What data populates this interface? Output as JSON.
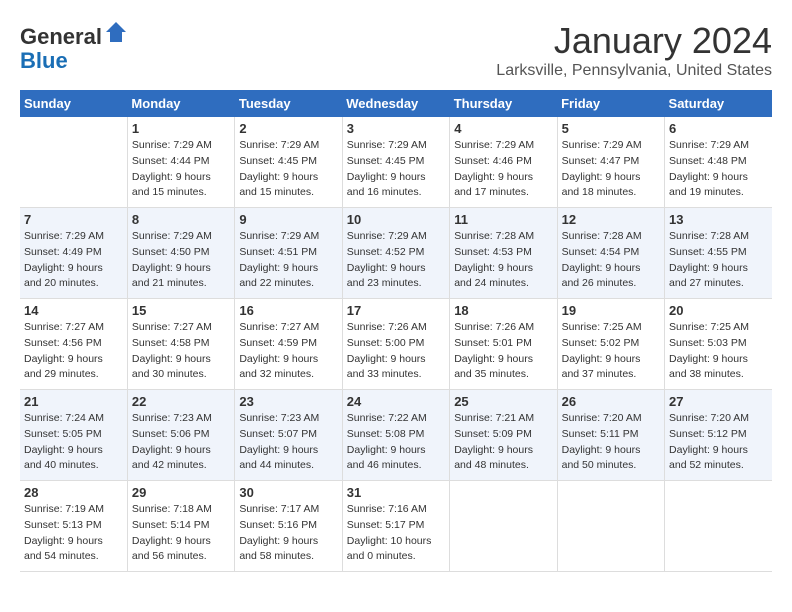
{
  "header": {
    "logo_general": "General",
    "logo_blue": "Blue",
    "month_title": "January 2024",
    "location": "Larksville, Pennsylvania, United States"
  },
  "days_of_week": [
    "Sunday",
    "Monday",
    "Tuesday",
    "Wednesday",
    "Thursday",
    "Friday",
    "Saturday"
  ],
  "weeks": [
    [
      {
        "day": "",
        "info": ""
      },
      {
        "day": "1",
        "info": "Sunrise: 7:29 AM\nSunset: 4:44 PM\nDaylight: 9 hours\nand 15 minutes."
      },
      {
        "day": "2",
        "info": "Sunrise: 7:29 AM\nSunset: 4:45 PM\nDaylight: 9 hours\nand 15 minutes."
      },
      {
        "day": "3",
        "info": "Sunrise: 7:29 AM\nSunset: 4:45 PM\nDaylight: 9 hours\nand 16 minutes."
      },
      {
        "day": "4",
        "info": "Sunrise: 7:29 AM\nSunset: 4:46 PM\nDaylight: 9 hours\nand 17 minutes."
      },
      {
        "day": "5",
        "info": "Sunrise: 7:29 AM\nSunset: 4:47 PM\nDaylight: 9 hours\nand 18 minutes."
      },
      {
        "day": "6",
        "info": "Sunrise: 7:29 AM\nSunset: 4:48 PM\nDaylight: 9 hours\nand 19 minutes."
      }
    ],
    [
      {
        "day": "7",
        "info": "Sunrise: 7:29 AM\nSunset: 4:49 PM\nDaylight: 9 hours\nand 20 minutes."
      },
      {
        "day": "8",
        "info": "Sunrise: 7:29 AM\nSunset: 4:50 PM\nDaylight: 9 hours\nand 21 minutes."
      },
      {
        "day": "9",
        "info": "Sunrise: 7:29 AM\nSunset: 4:51 PM\nDaylight: 9 hours\nand 22 minutes."
      },
      {
        "day": "10",
        "info": "Sunrise: 7:29 AM\nSunset: 4:52 PM\nDaylight: 9 hours\nand 23 minutes."
      },
      {
        "day": "11",
        "info": "Sunrise: 7:28 AM\nSunset: 4:53 PM\nDaylight: 9 hours\nand 24 minutes."
      },
      {
        "day": "12",
        "info": "Sunrise: 7:28 AM\nSunset: 4:54 PM\nDaylight: 9 hours\nand 26 minutes."
      },
      {
        "day": "13",
        "info": "Sunrise: 7:28 AM\nSunset: 4:55 PM\nDaylight: 9 hours\nand 27 minutes."
      }
    ],
    [
      {
        "day": "14",
        "info": "Sunrise: 7:27 AM\nSunset: 4:56 PM\nDaylight: 9 hours\nand 29 minutes."
      },
      {
        "day": "15",
        "info": "Sunrise: 7:27 AM\nSunset: 4:58 PM\nDaylight: 9 hours\nand 30 minutes."
      },
      {
        "day": "16",
        "info": "Sunrise: 7:27 AM\nSunset: 4:59 PM\nDaylight: 9 hours\nand 32 minutes."
      },
      {
        "day": "17",
        "info": "Sunrise: 7:26 AM\nSunset: 5:00 PM\nDaylight: 9 hours\nand 33 minutes."
      },
      {
        "day": "18",
        "info": "Sunrise: 7:26 AM\nSunset: 5:01 PM\nDaylight: 9 hours\nand 35 minutes."
      },
      {
        "day": "19",
        "info": "Sunrise: 7:25 AM\nSunset: 5:02 PM\nDaylight: 9 hours\nand 37 minutes."
      },
      {
        "day": "20",
        "info": "Sunrise: 7:25 AM\nSunset: 5:03 PM\nDaylight: 9 hours\nand 38 minutes."
      }
    ],
    [
      {
        "day": "21",
        "info": "Sunrise: 7:24 AM\nSunset: 5:05 PM\nDaylight: 9 hours\nand 40 minutes."
      },
      {
        "day": "22",
        "info": "Sunrise: 7:23 AM\nSunset: 5:06 PM\nDaylight: 9 hours\nand 42 minutes."
      },
      {
        "day": "23",
        "info": "Sunrise: 7:23 AM\nSunset: 5:07 PM\nDaylight: 9 hours\nand 44 minutes."
      },
      {
        "day": "24",
        "info": "Sunrise: 7:22 AM\nSunset: 5:08 PM\nDaylight: 9 hours\nand 46 minutes."
      },
      {
        "day": "25",
        "info": "Sunrise: 7:21 AM\nSunset: 5:09 PM\nDaylight: 9 hours\nand 48 minutes."
      },
      {
        "day": "26",
        "info": "Sunrise: 7:20 AM\nSunset: 5:11 PM\nDaylight: 9 hours\nand 50 minutes."
      },
      {
        "day": "27",
        "info": "Sunrise: 7:20 AM\nSunset: 5:12 PM\nDaylight: 9 hours\nand 52 minutes."
      }
    ],
    [
      {
        "day": "28",
        "info": "Sunrise: 7:19 AM\nSunset: 5:13 PM\nDaylight: 9 hours\nand 54 minutes."
      },
      {
        "day": "29",
        "info": "Sunrise: 7:18 AM\nSunset: 5:14 PM\nDaylight: 9 hours\nand 56 minutes."
      },
      {
        "day": "30",
        "info": "Sunrise: 7:17 AM\nSunset: 5:16 PM\nDaylight: 9 hours\nand 58 minutes."
      },
      {
        "day": "31",
        "info": "Sunrise: 7:16 AM\nSunset: 5:17 PM\nDaylight: 10 hours\nand 0 minutes."
      },
      {
        "day": "",
        "info": ""
      },
      {
        "day": "",
        "info": ""
      },
      {
        "day": "",
        "info": ""
      }
    ]
  ]
}
